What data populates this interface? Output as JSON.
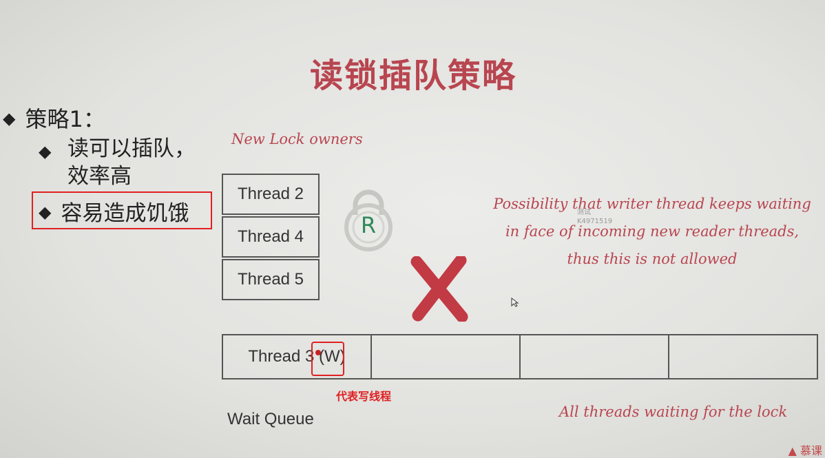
{
  "slide": {
    "title": "读锁插队策略",
    "bullets": {
      "level1": "策略1：",
      "level2a": "读可以插队，效率高",
      "level2b": "容易造成饥饿",
      "diamond": "◆"
    }
  },
  "diagram": {
    "new_owners_label": "New Lock owners",
    "owner_threads": [
      "Thread 2",
      "Thread 4",
      "Thread 5"
    ],
    "lock_letter": "R",
    "possibility_text": "Possibility that writer thread keeps waiting in face of incoming new reader threads, thus this is not allowed",
    "queue": [
      "Thread 3 (W)",
      "",
      "",
      ""
    ],
    "annotation": "代表写线程",
    "wait_queue_label": "Wait Queue",
    "all_threads_label": "All threads waiting for the lock",
    "watermark_line1": "测试",
    "watermark_line2": "K4971519",
    "corner_text": "▲ 慕课"
  },
  "colors": {
    "accent": "#b8454f",
    "highlight": "#e02020",
    "lock_green": "#2f8a5a",
    "x_red": "#c23a44"
  }
}
